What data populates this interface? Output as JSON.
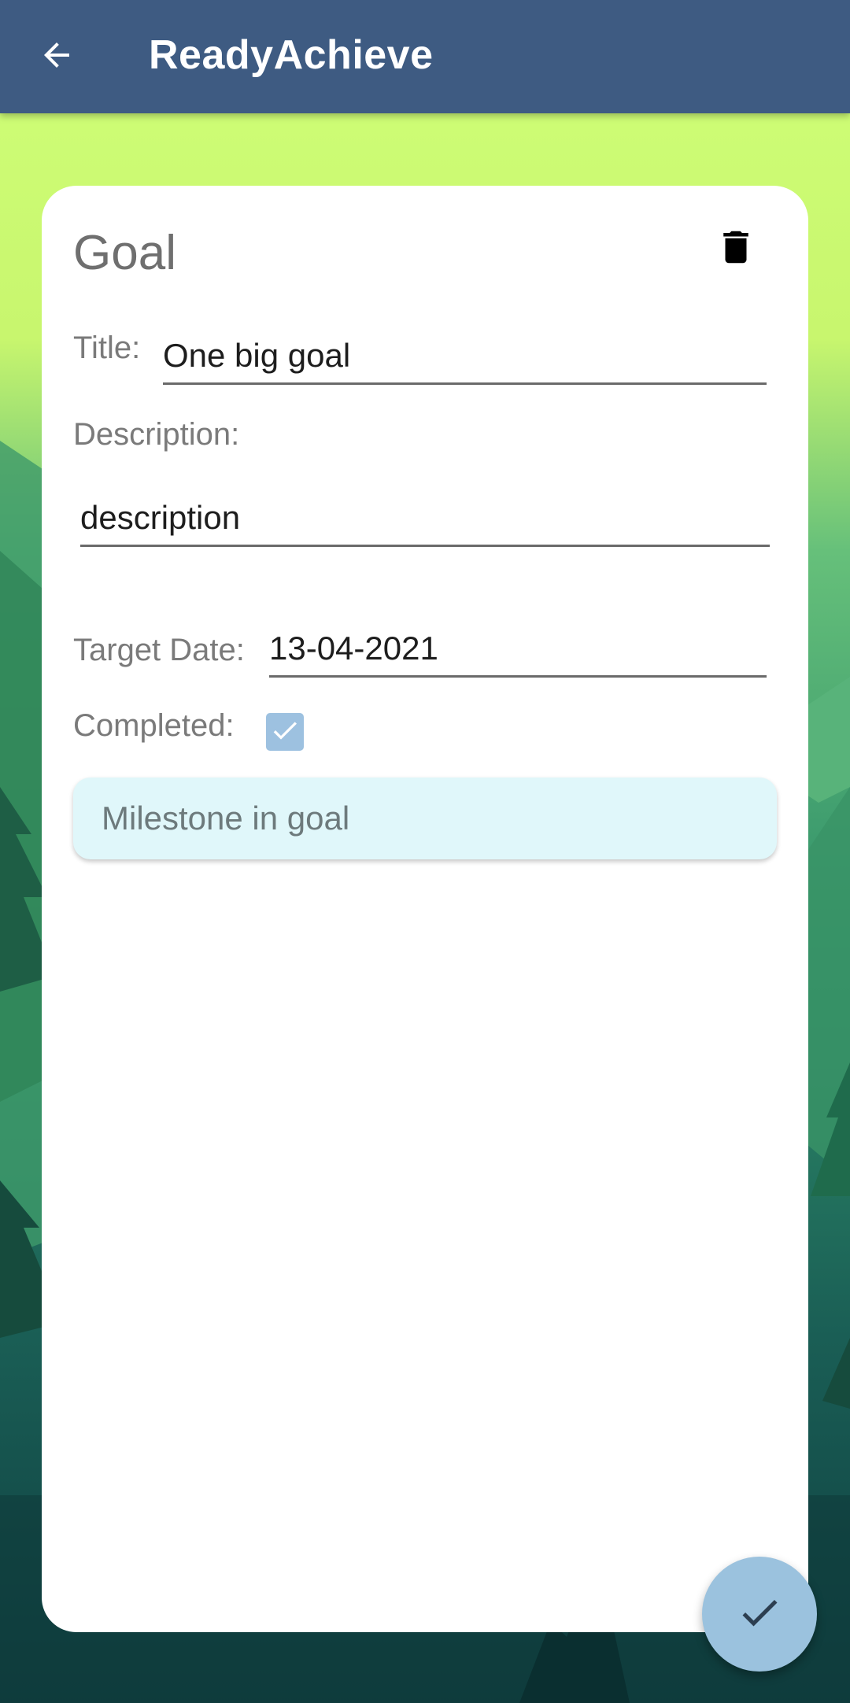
{
  "app_bar": {
    "title": "ReadyAchieve",
    "back_icon": "arrow-back-icon"
  },
  "card": {
    "heading": "Goal",
    "delete_icon": "trash-icon",
    "title_label": "Title:",
    "title_value": "One big goal",
    "description_label": "Description:",
    "description_value": "description",
    "target_date_label": "Target Date:",
    "target_date_value": "13-04-2021",
    "completed_label": "Completed:",
    "completed_checked": true,
    "milestone_label": "Milestone in goal"
  },
  "fab": {
    "icon": "check-icon"
  },
  "colors": {
    "app_bar": "#3e5b82",
    "checkbox": "#9dc1e0",
    "milestone_bg": "#e0f7fa",
    "fab": "#9bc2de"
  }
}
